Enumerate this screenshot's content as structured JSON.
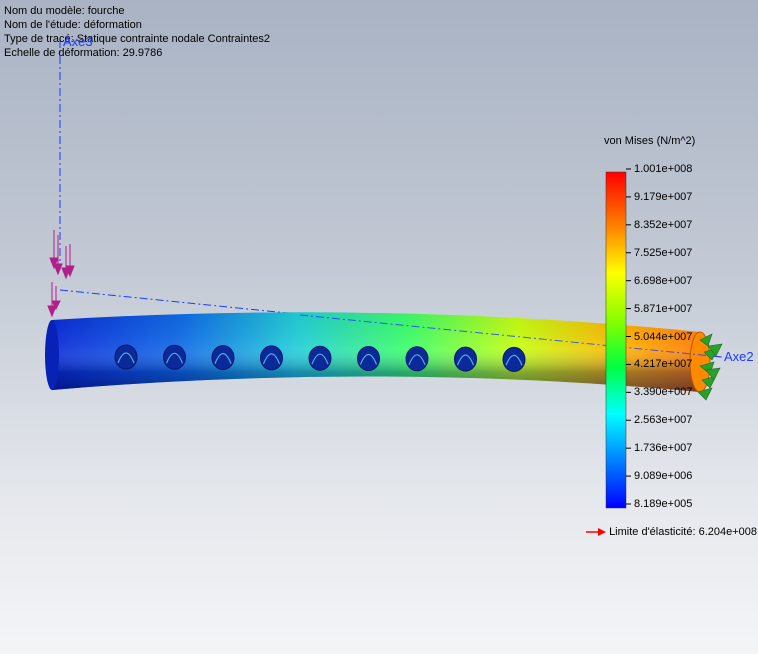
{
  "info": {
    "model_name": "Nom du modèle: fourche",
    "study_name": "Nom de l'étude: déformation",
    "plot_type": "Type de tracé: Statique contrainte nodale Contraintes2",
    "deformation_scale": "Echelle de déformation: 29.9786"
  },
  "legend": {
    "title": "von Mises (N/m^2)",
    "ticks": [
      "1.001e+008",
      "9.179e+007",
      "8.352e+007",
      "7.525e+007",
      "6.698e+007",
      "5.871e+007",
      "5.044e+007",
      "4.217e+007",
      "3.390e+007",
      "2.563e+007",
      "1.736e+007",
      "9.089e+006",
      "8.189e+005"
    ],
    "colorscale": [
      "#ff0000",
      "#ff8000",
      "#ffff00",
      "#80ff00",
      "#00ff40",
      "#00ffff",
      "#0080ff",
      "#0000ff"
    ]
  },
  "yield": {
    "label": "Limite d'élasticité: 6.204e+008",
    "arrow_color": "#ff0000"
  },
  "axes": {
    "axis3": "Axe3",
    "axis2": "Axe2",
    "axis_color": "#1a3cff"
  },
  "load_color": "#b0208a",
  "fixture_color": "#2aa02a",
  "holes_count": 9
}
